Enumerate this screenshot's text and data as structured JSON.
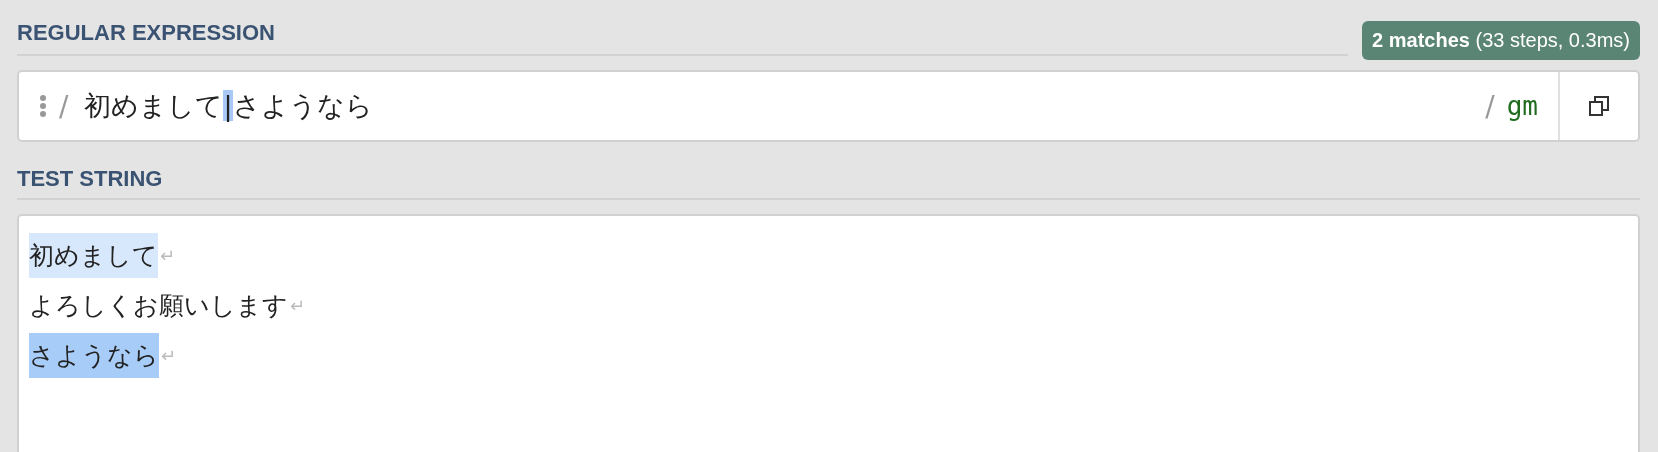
{
  "regex_section": {
    "heading": "REGULAR EXPRESSION",
    "result_badge": "**2 matches** (33 steps, 0.3ms)",
    "delimiter_open": "/",
    "delimiter_close": "/",
    "flags": "gm",
    "pattern": [
      {
        "text": "初めまして",
        "selected": false
      },
      {
        "text": "|",
        "selected": true
      },
      {
        "text": "さようなら",
        "selected": false
      }
    ]
  },
  "test_section": {
    "heading": "TEST STRING",
    "lines": [
      {
        "text": "初めまして",
        "color": "#d8e8fc",
        "eol": "↵"
      },
      {
        "text": "よろしくお願いします",
        "eol": "↵"
      },
      {
        "text": "さようなら",
        "color": "#a8ccf8",
        "eol": "↵"
      }
    ]
  }
}
